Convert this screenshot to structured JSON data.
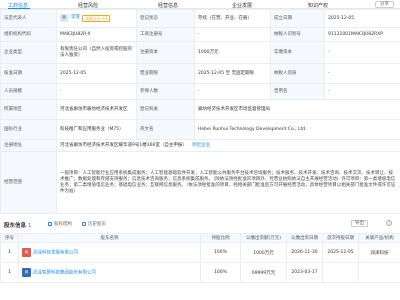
{
  "tabs": [
    "工商信息",
    "经营风险",
    "经营信息",
    "企业发展",
    "知识产权"
  ],
  "share_label": "分享",
  "info": {
    "rep_label": "法定代表人",
    "rep_name": "李雪",
    "rep_badge": "关联企业 44",
    "status_label": "登记状态",
    "status_value": "存续（在营、开业、在册）",
    "est_label": "成立日期",
    "est_value": "2025-12-05",
    "org_label": "组织机构代码",
    "org_value": "MAK3JU82R-X",
    "reg_no_label": "工商注册号",
    "reg_no_value": "-",
    "ucc_label": "纳税人识别号",
    "ucc_value": "91131001MAK3JU82RXP",
    "type_label": "企业类型",
    "type_value": "有限责任公司（自然人投资或控股的法人独资）",
    "cap_label": "注册资本",
    "cap_value": "1000万元",
    "paid_label": "实缴资本",
    "paid_value": "-",
    "approve_label": "核准日期",
    "approve_value": "2025-12-05",
    "approve_badge": "无固定期限",
    "term_label": "营业期限",
    "term_value": "2025-12-05 至 无固定期限",
    "taxpayer_label": "纳税人资质",
    "taxpayer_value": "-",
    "staff_label": "人员规模",
    "staff_value": "-",
    "insured_label": "参保人数",
    "insured_value": "-",
    "formerly_label": "曾用名",
    "formerly_value": "-",
    "region_label": "所属地区",
    "region_value": "河北省廊坊市廊坊经济技术开发区",
    "authority_label": "登记机关",
    "authority_value": "廊坊经济技术开发区市场监督管理局",
    "industry_label": "国标行业",
    "industry_value": "科技推广和应用服务业（M75）",
    "eng_label": "英文名",
    "eng_value": "Hebei Runhui Technology Development Co., Ltd.",
    "address_label": "注册地址",
    "address_value": "河北省廊坊市经济技术开发区耀华道9号1楼366室（自主申报）",
    "address_link": "附近企业",
    "scope_label": "经营范围",
    "scope_value": "一般项目：人工智能行业应用系统集成服务；人工智能基础软件开发；人工智能公共服务平台技术咨询服务；技术服务、技术开发、技术咨询、技术交流、技术转让、技术推广；数据处理和存储支持服务；信息技术咨询服务；信息系统集成服务。（除依法须经批准的项目外，凭营业执照依法自主开展经营活动）许可项目：第一类增值电信业务；第二类增值电信业务；基础电信业务；互联网信息服务。（依法须经批准的项目，经相关部门批准后方可开展经营活动，具体经营项目以相关部门批准文件或许可证件为准）"
  },
  "shareholders": {
    "title": "股东信息",
    "count": "1",
    "link1": "股权结构",
    "link2": "历史股东",
    "export_label": "导出",
    "help": "?",
    "headers": [
      "序号",
      "股东名称",
      "持股比例",
      "认缴出资额(万元)",
      "认缴出资日期",
      "首次持股日期",
      "关联产品/机构"
    ],
    "rows": [
      {
        "idx": "1",
        "name": "润泽科技发展有限公司",
        "ratio": "100%",
        "amount": "1000万元",
        "date": "2026-11-30",
        "first": "2025-12-05",
        "product": "润泽科技"
      },
      {
        "idx": "1",
        "name": "润泽智算科技集团股份有限公司",
        "ratio": "100%",
        "amount": "69999万元",
        "date": "2023-03-17",
        "first": "",
        "product": ""
      }
    ]
  },
  "colors": {
    "accent": "#128bed",
    "label_bg": "#f5f8fc",
    "border": "#e8eef4"
  }
}
